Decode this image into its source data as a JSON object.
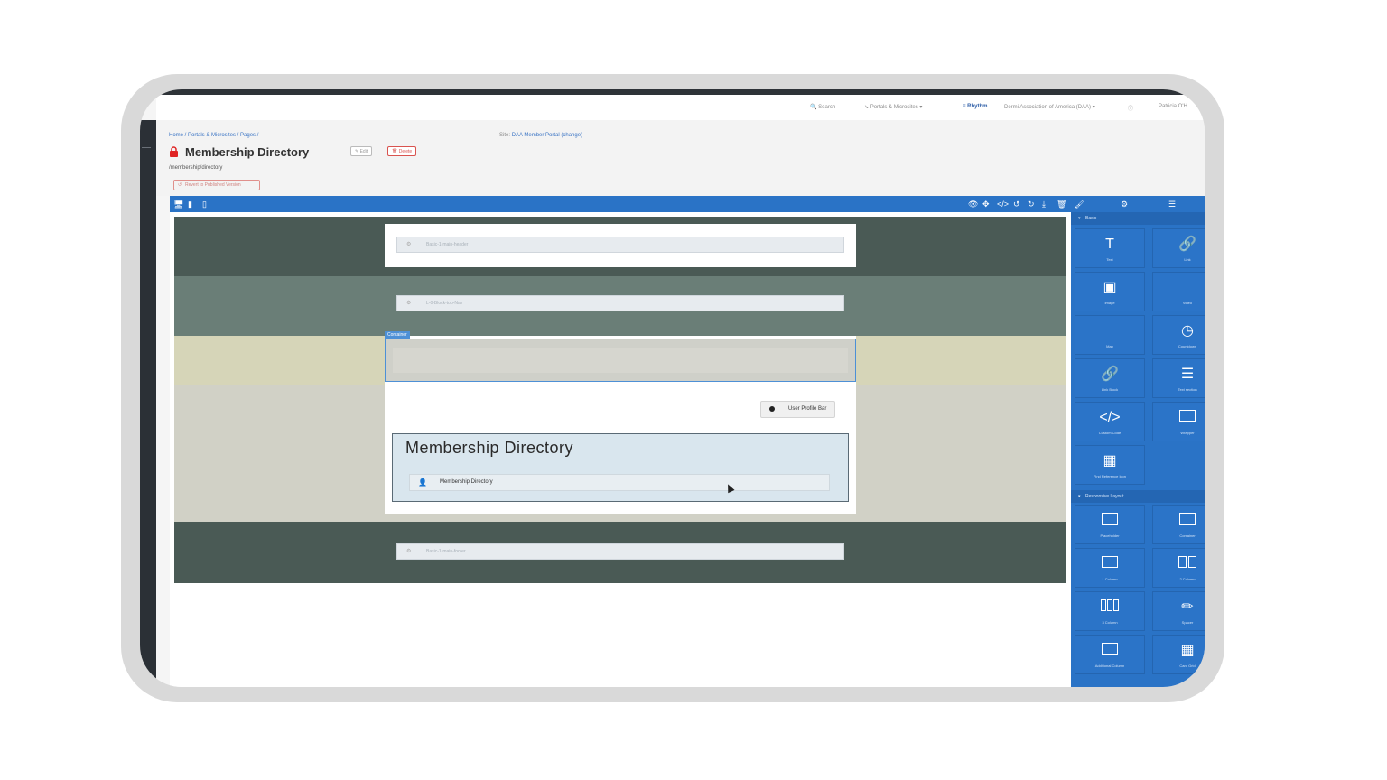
{
  "topnav": {
    "search": "Search",
    "portals": "Portals & Microsites",
    "rhythm": "Rhythm",
    "association": "Dermi Association of America (DAA)",
    "user": "Patricia O'H..."
  },
  "page": {
    "breadcrumb": "Home / Portals & Microsites / Pages /",
    "site_label": "Site:",
    "site_value": "DAA Member Portal (change)",
    "title": "Membership Directory",
    "edit_label": "Edit",
    "delete_label": "Delete",
    "slug": "/membership/directory",
    "revert_label": "Revert to Published Version"
  },
  "canvas": {
    "header_block": "Basic-1-main-header",
    "nav_block": "L-0-Block-top-Nav",
    "container_tag": "Container",
    "profile_button": "User Profile Bar",
    "directory_title": "Membership Directory",
    "directory_item": "Membership Directory",
    "footer_block": "Basic-1-main-footer"
  },
  "sidebar": {
    "basic_title": "Basic",
    "layout_title": "Responsive Layout",
    "basic_items": [
      {
        "label": "Text",
        "icon": "text-icon"
      },
      {
        "label": "Link",
        "icon": "link-icon"
      },
      {
        "label": "Image",
        "icon": "image-icon"
      },
      {
        "label": "Video",
        "icon": "video-icon"
      },
      {
        "label": "Map",
        "icon": "map-icon"
      },
      {
        "label": "Countdown",
        "icon": "clock-icon"
      },
      {
        "label": "Link Block",
        "icon": "link-icon"
      },
      {
        "label": "Text section",
        "icon": "text-section-icon"
      },
      {
        "label": "Custom Code",
        "icon": "code-icon"
      },
      {
        "label": "Wrapper",
        "icon": "wrapper-icon"
      },
      {
        "label": "Find Reference Icon",
        "icon": "shapes-icon"
      }
    ],
    "layout_items": [
      {
        "label": "Placeholder",
        "icon": "box-icon"
      },
      {
        "label": "Container",
        "icon": "box-icon"
      },
      {
        "label": "1 Column",
        "icon": "box-icon"
      },
      {
        "label": "2 Column",
        "icon": "two-column-icon"
      },
      {
        "label": "3 Column",
        "icon": "three-column-icon"
      },
      {
        "label": "Spacer",
        "icon": "ruler-icon"
      },
      {
        "label": "Additional Column",
        "icon": "box-icon"
      },
      {
        "label": "Card Grid",
        "icon": "grid-icon"
      }
    ]
  }
}
